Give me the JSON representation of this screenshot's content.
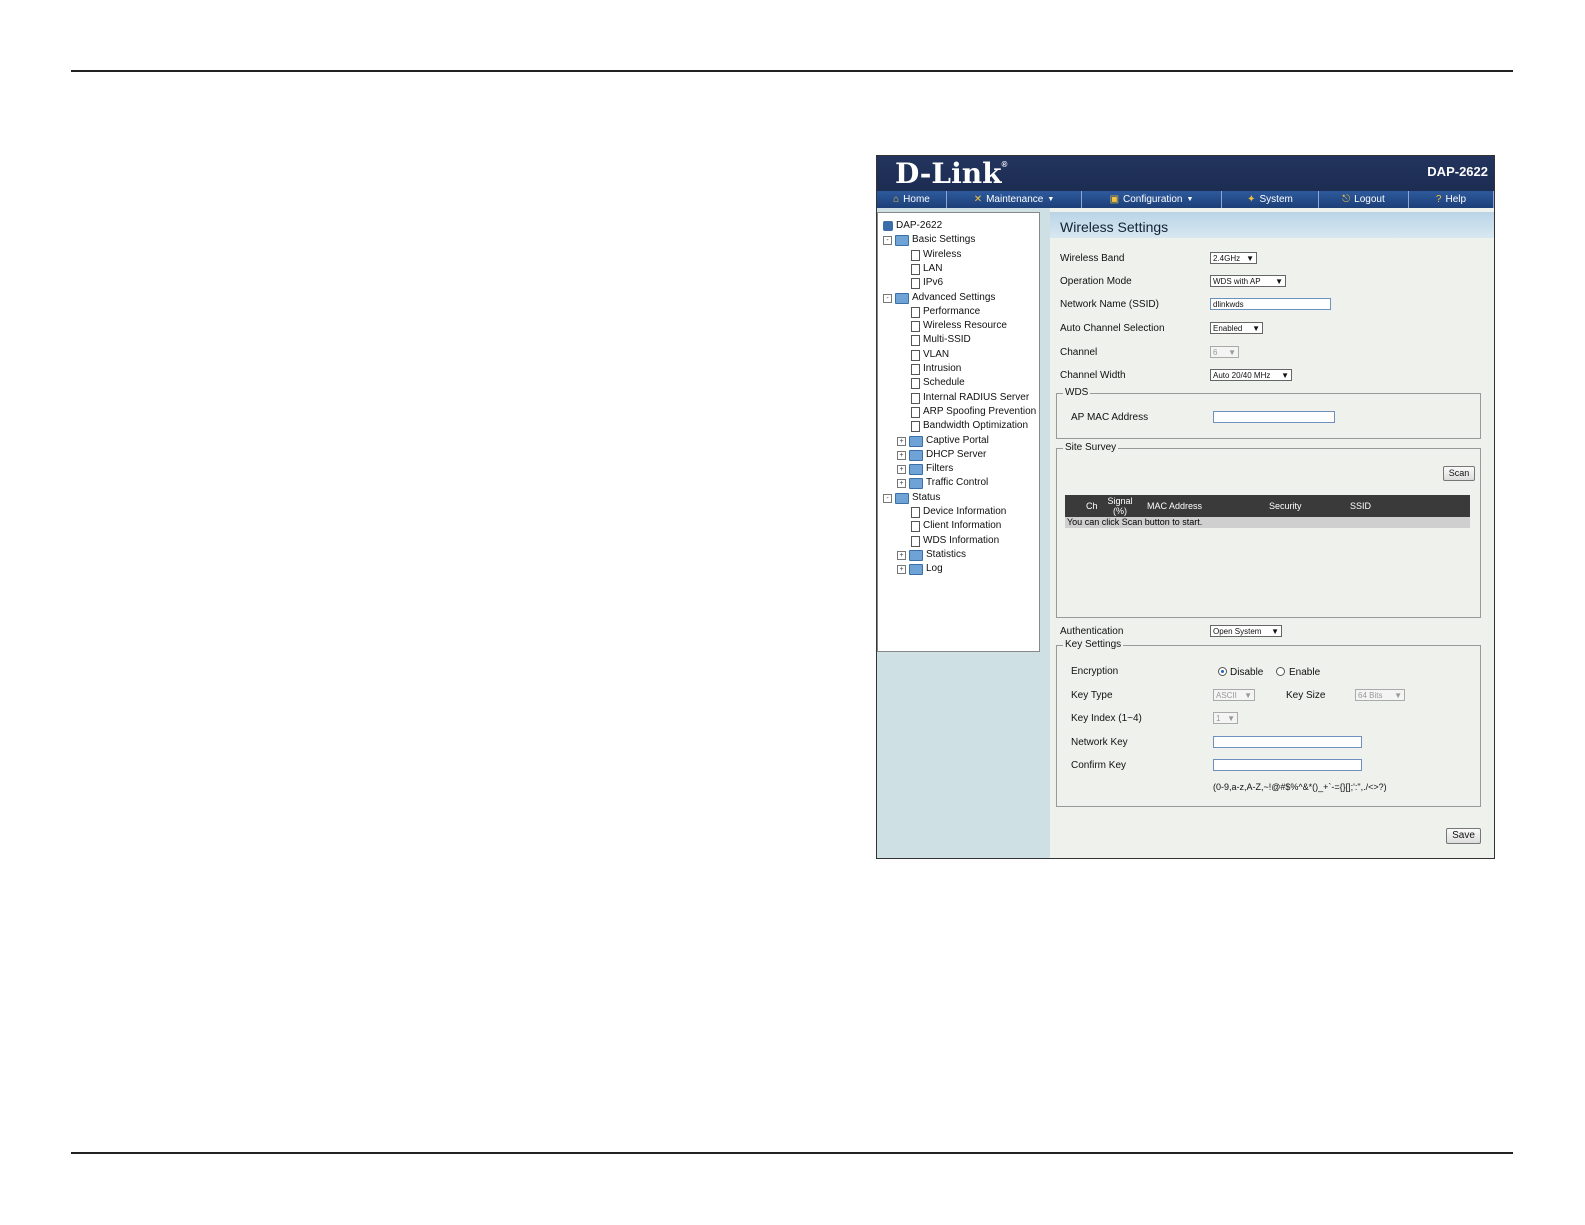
{
  "header": {
    "brand": "D-Link",
    "trademark": "®",
    "model": "DAP-2622"
  },
  "menu": [
    {
      "label": "Home",
      "icon": "home-icon",
      "glyph": "⌂",
      "dropdown": false
    },
    {
      "label": "Maintenance",
      "icon": "tools-icon",
      "glyph": "✕",
      "dropdown": true
    },
    {
      "label": "Configuration",
      "icon": "disk-icon",
      "glyph": "▣",
      "dropdown": true
    },
    {
      "label": "System",
      "icon": "system-icon",
      "glyph": "✦",
      "dropdown": false
    },
    {
      "label": "Logout",
      "icon": "logout-icon",
      "glyph": "⎋",
      "dropdown": false
    },
    {
      "label": "Help",
      "icon": "help-icon",
      "glyph": "?",
      "dropdown": false
    }
  ],
  "sidebar": {
    "root": "DAP-2622",
    "basic": {
      "label": "Basic Settings",
      "items": [
        "Wireless",
        "LAN",
        "IPv6"
      ]
    },
    "advanced": {
      "label": "Advanced Settings",
      "items": [
        "Performance",
        "Wireless Resource",
        "Multi-SSID",
        "VLAN",
        "Intrusion",
        "Schedule",
        "Internal RADIUS Server",
        "ARP Spoofing Prevention",
        "Bandwidth Optimization"
      ],
      "folders": [
        "Captive Portal",
        "DHCP Server",
        "Filters",
        "Traffic Control"
      ]
    },
    "status": {
      "label": "Status",
      "items": [
        "Device Information",
        "Client Information",
        "WDS Information"
      ],
      "folders": [
        "Statistics",
        "Log"
      ]
    }
  },
  "page": {
    "title": "Wireless Settings",
    "wireless_band": {
      "label": "Wireless Band",
      "value": "2.4GHz"
    },
    "operation_mode": {
      "label": "Operation Mode",
      "value": "WDS with AP"
    },
    "ssid": {
      "label": "Network Name (SSID)",
      "value": "dlinkwds"
    },
    "auto_channel": {
      "label": "Auto Channel Selection",
      "value": "Enabled"
    },
    "channel": {
      "label": "Channel",
      "value": "6"
    },
    "channel_width": {
      "label": "Channel Width",
      "value": "Auto 20/40 MHz"
    },
    "wds": {
      "legend": "WDS",
      "ap_mac_label": "AP MAC Address",
      "ap_mac_value": ""
    },
    "site_survey": {
      "legend": "Site Survey",
      "scan_label": "Scan",
      "columns": [
        "Ch",
        "Signal (%)",
        "MAC Address",
        "Security",
        "SSID"
      ],
      "message": "You can click Scan button to start."
    },
    "authentication": {
      "label": "Authentication",
      "value": "Open System"
    },
    "key_settings": {
      "legend": "Key Settings",
      "encryption_label": "Encryption",
      "disable_label": "Disable",
      "enable_label": "Enable",
      "encryption_selected": "Disable",
      "key_type_label": "Key Type",
      "key_type_value": "ASCII",
      "key_size_label": "Key Size",
      "key_size_value": "64 Bits",
      "key_index_label": "Key Index (1~4)",
      "key_index_value": "1",
      "network_key_label": "Network Key",
      "confirm_key_label": "Confirm Key",
      "hint": "(0-9,a-z,A-Z,~!@#$%^&*()_+`-={}[];':\",./<>?)"
    },
    "save_label": "Save"
  }
}
